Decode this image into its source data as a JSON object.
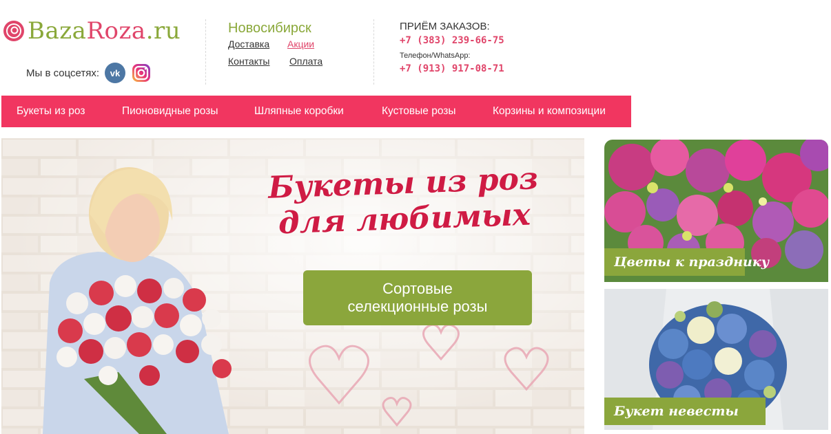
{
  "header": {
    "logo_text_main": "Baza",
    "logo_text_accent": "Roza",
    "logo_text_tld": ".ru",
    "social_label": "Мы в соцсетях:",
    "vk_icon_text": "vk",
    "city": "Новосибирск",
    "links": [
      "Доставка",
      "Акции",
      "Контакты",
      "Оплата"
    ],
    "orders_title": "ПРИЁМ ЗАКАЗОВ:",
    "phone_1": "+7 (383) 239-66-75",
    "phone_label": "Телефон/WhatsApp:",
    "phone_2": "+7 (913) 917-08-71"
  },
  "menu": {
    "items": [
      "Букеты из роз",
      "Пионовидные розы",
      "Шляпные коробки",
      "Кустовые розы",
      "Корзины и композиции"
    ]
  },
  "banner": {
    "title_line1": "Букеты из роз",
    "title_line2": "для любимых",
    "button_line1": "Сортовые",
    "button_line2": "селекционные розы"
  },
  "tiles": [
    {
      "label": "Цветы к празднику"
    },
    {
      "label": "Букет невесты"
    }
  ],
  "colors": {
    "brand_green": "#8ba63c",
    "brand_pink": "#f13660",
    "accent_red": "#e0456a"
  }
}
